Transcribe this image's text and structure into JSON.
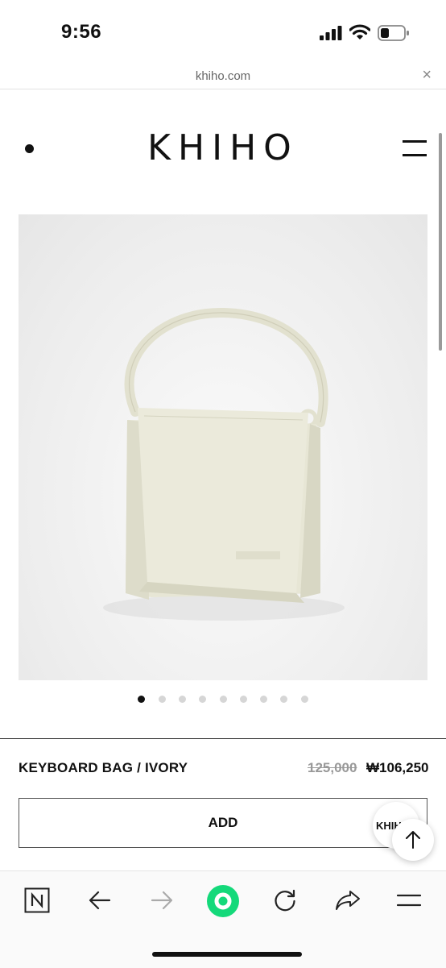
{
  "status_bar": {
    "time": "9:56"
  },
  "browser": {
    "url": "khiho.com"
  },
  "site": {
    "logo": "KHIHO"
  },
  "product": {
    "name": "KEYBOARD BAG / IVORY",
    "original_price": "125,000",
    "sale_price": "₩106,250",
    "image_count": 9,
    "active_image": 1,
    "add_label": "ADD"
  },
  "chat_widget": {
    "label": "KHIHO"
  },
  "colors": {
    "accent_green": "#14d97a",
    "bag": "#e5e5d3"
  },
  "toolbar": {
    "icons": [
      "naver-icon",
      "back-icon",
      "forward-icon",
      "green-dot-icon",
      "reload-icon",
      "share-icon",
      "menu-icon"
    ]
  }
}
